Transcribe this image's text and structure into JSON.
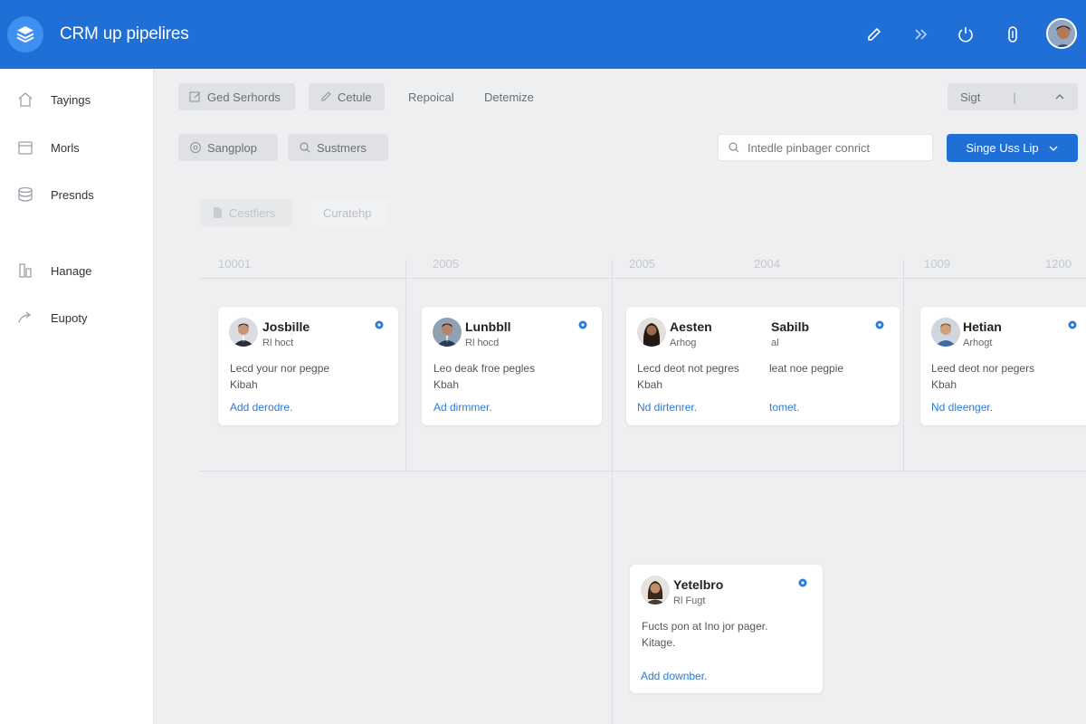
{
  "header": {
    "title": "CRM up pipelires",
    "icons": [
      "pencil-icon",
      "chevrons-icon",
      "power-icon",
      "clip-icon"
    ],
    "colors": {
      "primary": "#1f6fd6",
      "background": "#eeeff1",
      "link": "#2a7bd9"
    }
  },
  "sidebar": {
    "items": [
      {
        "label": "Tayings",
        "icon": "home-icon"
      },
      {
        "label": "Morls",
        "icon": "calendar-icon"
      },
      {
        "label": "Presnds",
        "icon": "stack-icon"
      },
      {
        "label": "Hanage",
        "icon": "building-icon"
      },
      {
        "label": "Eupoty",
        "icon": "share-icon"
      }
    ]
  },
  "toolbar": {
    "row1": [
      "Ged Serhords",
      "Cetule",
      "Repoical",
      "Detemize"
    ],
    "sign": {
      "label": "Sigt",
      "divider": "|"
    },
    "row2": [
      "Sangplop",
      "Sustmers"
    ],
    "search_placeholder": "Intedle pinbager conrict",
    "primary_label": "Singe Uss Lip",
    "row3": [
      "Cestfiers",
      "Curatehp"
    ]
  },
  "board": {
    "columns": [
      "10001",
      "2005",
      "2005",
      "2004",
      "1009",
      "1200"
    ],
    "cards": [
      {
        "name": "Josbille",
        "role": "Rl hoct",
        "desc1": "Lecd your nor pegpe",
        "desc2": "Kibah",
        "link": "Add derodre."
      },
      {
        "name": "Lunbbll",
        "role": "Rl hocd",
        "desc1": "Leo deak froe pegles",
        "desc2": "Kbah",
        "link": "Ad dirmmer."
      },
      {
        "name": "Aesten",
        "role": "Arhog",
        "desc1": "Lecd deot not pegres",
        "desc2": "Kbah",
        "link": "Nd dirtenrer.",
        "name2": "Sabilb",
        "role2": "al",
        "desc3": "leat noe pegpie",
        "link2": "tomet."
      },
      {
        "name": "Hetian",
        "role": "Arhogt",
        "desc1": "Leed deot nor pegers",
        "desc2": "Kbah",
        "link": "Nd dleenger."
      },
      {
        "name": "Yetelbro",
        "role": "Rl Fugt",
        "desc1": "Fucts pon at Ino jor pager.",
        "desc2": "Kitage.",
        "link": "Add downber."
      }
    ]
  }
}
